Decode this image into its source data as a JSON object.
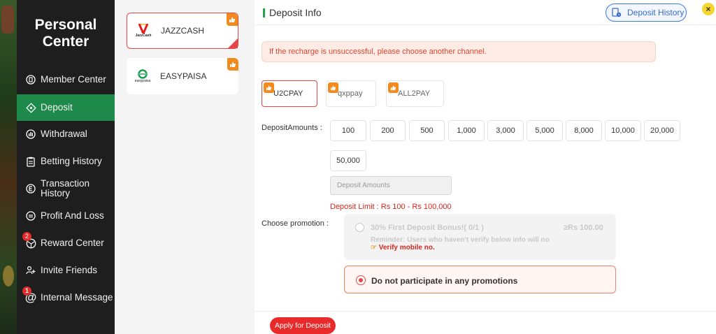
{
  "sidebar": {
    "title_line1": "Personal",
    "title_line2": "Center",
    "items": [
      {
        "label": "Member Center"
      },
      {
        "label": "Deposit"
      },
      {
        "label": "Withdrawal"
      },
      {
        "label": "Betting History"
      },
      {
        "label_line1": "Transaction",
        "label_line2": "History"
      },
      {
        "label": "Profit And Loss"
      },
      {
        "label": "Reward Center",
        "badge": "2"
      },
      {
        "label": "Invite Friends"
      },
      {
        "label": "Internal Message",
        "badge": "1"
      }
    ]
  },
  "channels": [
    {
      "name": "JAZZCASH",
      "logo_text": "JazzCash",
      "selected": true
    },
    {
      "name": "EASYPAISA",
      "logo_text": "easypaisa",
      "selected": false
    }
  ],
  "header": {
    "title": "Deposit Info",
    "deposit_history": "Deposit History",
    "close": "×"
  },
  "notice": "If the recharge is unsuccessful, please choose another channel.",
  "pay_channels": [
    {
      "name": "U2CPAY",
      "selected": true
    },
    {
      "name": "qxppay",
      "selected": false
    },
    {
      "name": "ALL2PAY",
      "selected": false
    }
  ],
  "amounts": {
    "label": "DepositAmounts :",
    "options": [
      "100",
      "200",
      "500",
      "1,000",
      "3,000",
      "5,000",
      "8,000",
      "10,000",
      "20,000",
      "50,000"
    ],
    "input_placeholder": "Deposit Amounts",
    "limit": "Deposit Limit :  Rs  100  -  Rs  100,000"
  },
  "promotion": {
    "label": "Choose promotion :",
    "first": {
      "title": "30% First Deposit Bonus!( 0/1 )",
      "amount": "≥Rs  100.00",
      "reminder": "Reminder: Users who haven't verify below info will no",
      "verify": "Verify mobile no."
    },
    "second": {
      "title": "Do not participate in any promotions"
    }
  },
  "apply_button": "Apply for Deposit",
  "colors": {
    "active_green": "#1d8a4c",
    "accent_red": "#e84545",
    "badge_orange": "#f28a1e"
  }
}
